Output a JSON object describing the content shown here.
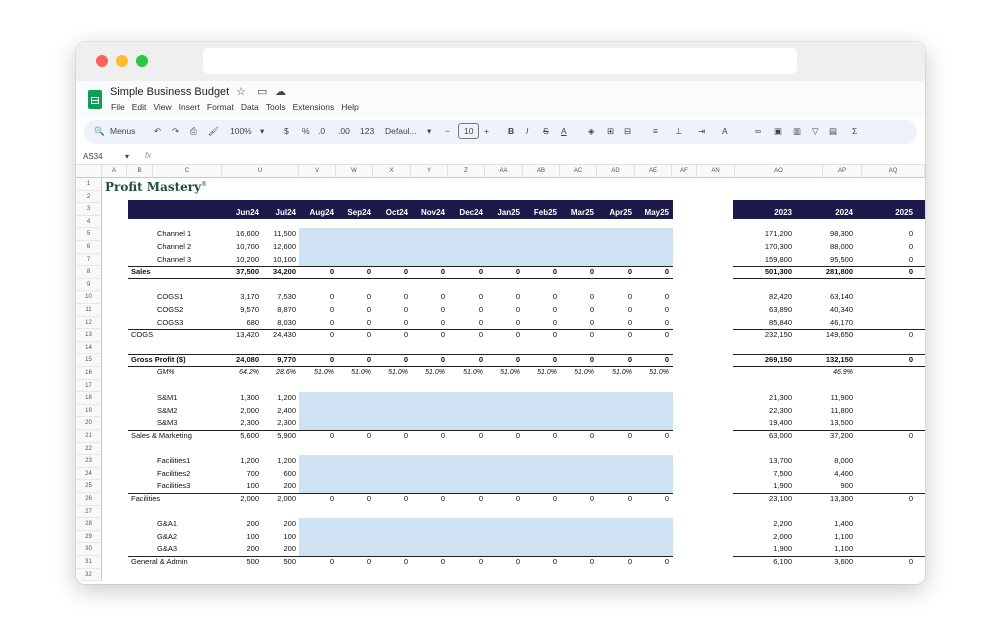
{
  "app": {
    "title": "Simple Business Budget",
    "menus": [
      "File",
      "Edit",
      "View",
      "Insert",
      "Format",
      "Data",
      "Tools",
      "Extensions",
      "Help"
    ]
  },
  "toolbar": {
    "search": "Menus",
    "zoom": "100%",
    "currency": "$",
    "percent": "%",
    "dec_less": ".0",
    "dec_more": ".00",
    "num_format": "123",
    "font": "Defaul...",
    "font_size": "10"
  },
  "formula_bar": {
    "cell_ref": "AS34",
    "fx": "fx"
  },
  "sheet": {
    "logo": "Profit Mastery",
    "logo_mark": "®",
    "columns": [
      "A",
      "B",
      "C",
      "U",
      "V",
      "W",
      "X",
      "Y",
      "Z",
      "AA",
      "AB",
      "AC",
      "AD",
      "AE",
      "AF",
      "AN",
      "AO",
      "AP",
      "AQ"
    ],
    "row_numbers": [
      "1",
      "2",
      "3",
      "4",
      "5",
      "6",
      "7",
      "8",
      "9",
      "10",
      "11",
      "12",
      "13",
      "14",
      "15",
      "16",
      "17",
      "18",
      "19",
      "20",
      "21",
      "22",
      "23",
      "24",
      "25",
      "26",
      "27",
      "28",
      "29",
      "30",
      "31",
      "32"
    ],
    "month_headers": [
      "Jun24",
      "Jul24",
      "Aug24",
      "Sep24",
      "Oct24",
      "Nov24",
      "Dec24",
      "Jan25",
      "Feb25",
      "Mar25",
      "Apr25",
      "May25"
    ],
    "year_headers": [
      "2023",
      "2024",
      "2025"
    ],
    "rows": [
      {
        "r": 5,
        "label": "Channel 1",
        "indent": true,
        "m": [
          "16,600",
          "11,500"
        ],
        "y": [
          "171,200",
          "98,300",
          "0"
        ]
      },
      {
        "r": 6,
        "label": "Channel 2",
        "indent": true,
        "m": [
          "10,700",
          "12,600"
        ],
        "y": [
          "170,300",
          "88,000",
          "0"
        ]
      },
      {
        "r": 7,
        "label": "Channel 3",
        "indent": true,
        "m": [
          "10,200",
          "10,100"
        ],
        "y": [
          "159,800",
          "95,500",
          "0"
        ]
      },
      {
        "r": 8,
        "label": "Sales",
        "bold": true,
        "m": [
          "37,500",
          "34,200",
          "0",
          "0",
          "0",
          "0",
          "0",
          "0",
          "0",
          "0",
          "0",
          "0"
        ],
        "y": [
          "501,300",
          "281,800",
          "0"
        ]
      },
      {
        "r": 10,
        "label": "COGS1",
        "indent": true,
        "m": [
          "3,170",
          "7,530",
          "0",
          "0",
          "0",
          "0",
          "0",
          "0",
          "0",
          "0",
          "0",
          "0"
        ],
        "y": [
          "82,420",
          "63,140",
          ""
        ]
      },
      {
        "r": 11,
        "label": "COGS2",
        "indent": true,
        "m": [
          "9,570",
          "8,870",
          "0",
          "0",
          "0",
          "0",
          "0",
          "0",
          "0",
          "0",
          "0",
          "0"
        ],
        "y": [
          "63,890",
          "40,340",
          ""
        ]
      },
      {
        "r": 12,
        "label": "COGS3",
        "indent": true,
        "m": [
          "680",
          "8,030",
          "0",
          "0",
          "0",
          "0",
          "0",
          "0",
          "0",
          "0",
          "0",
          "0"
        ],
        "y": [
          "85,840",
          "46,170",
          ""
        ]
      },
      {
        "r": 13,
        "label": "COGS",
        "m": [
          "13,420",
          "24,430",
          "0",
          "0",
          "0",
          "0",
          "0",
          "0",
          "0",
          "0",
          "0",
          "0"
        ],
        "y": [
          "232,150",
          "149,650",
          "0"
        ]
      },
      {
        "r": 15,
        "label": "Gross Profit ($)",
        "bold": true,
        "m": [
          "24,080",
          "9,770",
          "0",
          "0",
          "0",
          "0",
          "0",
          "0",
          "0",
          "0",
          "0",
          "0"
        ],
        "y": [
          "269,150",
          "132,150",
          "0"
        ]
      },
      {
        "r": 16,
        "label": "GM%",
        "indent": true,
        "ital": true,
        "m": [
          "64.2%",
          "28.6%",
          "51.0%",
          "51.0%",
          "51.0%",
          "51.0%",
          "51.0%",
          "51.0%",
          "51.0%",
          "51.0%",
          "51.0%",
          "51.0%"
        ],
        "y": [
          "",
          "46.9%",
          ""
        ]
      },
      {
        "r": 18,
        "label": "S&M1",
        "indent": true,
        "m": [
          "1,300",
          "1,200"
        ],
        "y": [
          "21,300",
          "11,900",
          ""
        ]
      },
      {
        "r": 19,
        "label": "S&M2",
        "indent": true,
        "m": [
          "2,000",
          "2,400"
        ],
        "y": [
          "22,300",
          "11,800",
          ""
        ]
      },
      {
        "r": 20,
        "label": "S&M3",
        "indent": true,
        "m": [
          "2,300",
          "2,300"
        ],
        "y": [
          "19,400",
          "13,500",
          ""
        ]
      },
      {
        "r": 21,
        "label": "Sales & Marketing",
        "m": [
          "5,600",
          "5,900",
          "0",
          "0",
          "0",
          "0",
          "0",
          "0",
          "0",
          "0",
          "0",
          "0"
        ],
        "y": [
          "63,000",
          "37,200",
          "0"
        ]
      },
      {
        "r": 23,
        "label": "Facilities1",
        "indent": true,
        "m": [
          "1,200",
          "1,200"
        ],
        "y": [
          "13,700",
          "8,000",
          ""
        ]
      },
      {
        "r": 24,
        "label": "Facilities2",
        "indent": true,
        "m": [
          "700",
          "600"
        ],
        "y": [
          "7,500",
          "4,400",
          ""
        ]
      },
      {
        "r": 25,
        "label": "Facilities3",
        "indent": true,
        "m": [
          "100",
          "200"
        ],
        "y": [
          "1,900",
          "900",
          ""
        ]
      },
      {
        "r": 26,
        "label": "Facilities",
        "m": [
          "2,000",
          "2,000",
          "0",
          "0",
          "0",
          "0",
          "0",
          "0",
          "0",
          "0",
          "0",
          "0"
        ],
        "y": [
          "23,100",
          "13,300",
          "0"
        ]
      },
      {
        "r": 28,
        "label": "G&A1",
        "indent": true,
        "m": [
          "200",
          "200"
        ],
        "y": [
          "2,200",
          "1,400",
          ""
        ]
      },
      {
        "r": 29,
        "label": "G&A2",
        "indent": true,
        "m": [
          "100",
          "100"
        ],
        "y": [
          "2,000",
          "1,100",
          ""
        ]
      },
      {
        "r": 30,
        "label": "G&A3",
        "indent": true,
        "m": [
          "200",
          "200"
        ],
        "y": [
          "1,900",
          "1,100",
          ""
        ]
      },
      {
        "r": 31,
        "label": "General & Admin",
        "m": [
          "500",
          "500",
          "0",
          "0",
          "0",
          "0",
          "0",
          "0",
          "0",
          "0",
          "0",
          "0"
        ],
        "y": [
          "6,100",
          "3,600",
          "0"
        ]
      }
    ]
  }
}
